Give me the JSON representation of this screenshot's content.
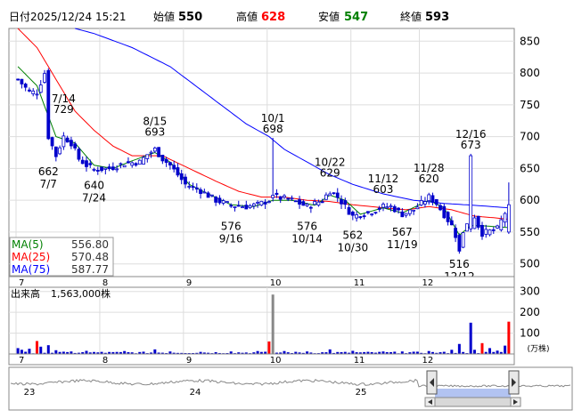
{
  "header": {
    "date_label": "日付",
    "date": "2025/12/24 15:21",
    "open_label": "始値",
    "open": "550",
    "high_label": "高値",
    "high": "628",
    "low_label": "安値",
    "low": "547",
    "close_label": "終値",
    "close": "593"
  },
  "colors": {
    "high": "#ff0000",
    "low": "#008000",
    "up": "#ffffff",
    "down": "#0000cc",
    "ma5": "#008000",
    "ma25": "#ff0000",
    "ma75": "#0000ff",
    "volume": "#0000cc",
    "volume_up": "#ff0000",
    "volume_spike": "#888888"
  },
  "legend": [
    {
      "label": "MA(5)",
      "value": "556.80",
      "color": "#008000"
    },
    {
      "label": "MA(25)",
      "value": "570.48",
      "color": "#ff0000"
    },
    {
      "label": "MA(75)",
      "value": "587.77",
      "color": "#0000ff"
    }
  ],
  "volume_label": "出来高",
  "volume_value": "1,563,000株",
  "volume_unit": "(万株)",
  "navigator_labels": [
    "23",
    "24",
    "25"
  ],
  "chart_data": [
    {
      "type": "candlestick",
      "ylim": [
        480,
        870
      ],
      "y_ticks": [
        500,
        550,
        600,
        650,
        700,
        750,
        800,
        850
      ],
      "month_labels": [
        "7",
        "8",
        "9",
        "10",
        "11",
        "12"
      ],
      "month_positions": [
        0,
        22,
        44,
        66,
        88,
        106
      ],
      "n": 130,
      "annotations": [
        {
          "date": "7/14",
          "value": "729",
          "i": 12,
          "kind": "high"
        },
        {
          "date": "7/7",
          "value": "662",
          "i": 8,
          "kind": "low"
        },
        {
          "date": "7/24",
          "value": "640",
          "i": 20,
          "kind": "low"
        },
        {
          "date": "8/15",
          "value": "693",
          "i": 36,
          "kind": "high"
        },
        {
          "date": "9/16",
          "value": "576",
          "i": 56,
          "kind": "low"
        },
        {
          "date": "10/1",
          "value": "698",
          "i": 67,
          "kind": "high"
        },
        {
          "date": "10/14",
          "value": "576",
          "i": 76,
          "kind": "low"
        },
        {
          "date": "10/22",
          "value": "629",
          "i": 82,
          "kind": "high"
        },
        {
          "date": "10/30",
          "value": "562",
          "i": 88,
          "kind": "low"
        },
        {
          "date": "11/12",
          "value": "603",
          "i": 96,
          "kind": "high"
        },
        {
          "date": "11/19",
          "value": "567",
          "i": 101,
          "kind": "low"
        },
        {
          "date": "11/28",
          "value": "620",
          "i": 108,
          "kind": "high"
        },
        {
          "date": "12/16",
          "value": "673",
          "i": 119,
          "kind": "high"
        },
        {
          "date": "12/12",
          "value": "516",
          "i": 116,
          "kind": "low"
        }
      ],
      "close_anchors": [
        [
          0,
          790
        ],
        [
          3,
          770
        ],
        [
          5,
          770
        ],
        [
          7,
          800
        ],
        [
          8,
          700
        ],
        [
          10,
          670
        ],
        [
          12,
          700
        ],
        [
          14,
          690
        ],
        [
          16,
          665
        ],
        [
          18,
          655
        ],
        [
          20,
          648
        ],
        [
          24,
          650
        ],
        [
          28,
          658
        ],
        [
          32,
          660
        ],
        [
          34,
          672
        ],
        [
          36,
          680
        ],
        [
          38,
          665
        ],
        [
          40,
          655
        ],
        [
          44,
          625
        ],
        [
          48,
          615
        ],
        [
          52,
          600
        ],
        [
          56,
          592
        ],
        [
          60,
          590
        ],
        [
          63,
          593
        ],
        [
          66,
          600
        ],
        [
          67,
          610
        ],
        [
          68,
          605
        ],
        [
          72,
          600
        ],
        [
          76,
          590
        ],
        [
          80,
          600
        ],
        [
          82,
          615
        ],
        [
          84,
          605
        ],
        [
          88,
          575
        ],
        [
          92,
          580
        ],
        [
          96,
          590
        ],
        [
          98,
          590
        ],
        [
          101,
          578
        ],
        [
          104,
          585
        ],
        [
          108,
          605
        ],
        [
          110,
          595
        ],
        [
          114,
          560
        ],
        [
          116,
          530
        ],
        [
          118,
          565
        ],
        [
          119,
          555
        ],
        [
          120,
          575
        ],
        [
          121,
          560
        ],
        [
          122,
          548
        ],
        [
          126,
          555
        ],
        [
          129,
          593
        ]
      ],
      "ma5_anchors": [
        [
          0,
          810
        ],
        [
          5,
          780
        ],
        [
          10,
          700
        ],
        [
          15,
          690
        ],
        [
          20,
          655
        ],
        [
          25,
          650
        ],
        [
          30,
          662
        ],
        [
          36,
          675
        ],
        [
          40,
          660
        ],
        [
          45,
          625
        ],
        [
          50,
          610
        ],
        [
          56,
          593
        ],
        [
          62,
          590
        ],
        [
          67,
          600
        ],
        [
          72,
          600
        ],
        [
          78,
          592
        ],
        [
          82,
          608
        ],
        [
          86,
          600
        ],
        [
          90,
          578
        ],
        [
          96,
          588
        ],
        [
          101,
          580
        ],
        [
          108,
          600
        ],
        [
          112,
          588
        ],
        [
          116,
          545
        ],
        [
          119,
          560
        ],
        [
          122,
          560
        ],
        [
          129,
          557
        ]
      ],
      "ma25_anchors": [
        [
          0,
          870
        ],
        [
          5,
          840
        ],
        [
          10,
          790
        ],
        [
          15,
          740
        ],
        [
          20,
          710
        ],
        [
          25,
          685
        ],
        [
          30,
          670
        ],
        [
          38,
          670
        ],
        [
          45,
          650
        ],
        [
          52,
          630
        ],
        [
          58,
          614
        ],
        [
          64,
          605
        ],
        [
          70,
          605
        ],
        [
          76,
          600
        ],
        [
          82,
          598
        ],
        [
          88,
          593
        ],
        [
          96,
          588
        ],
        [
          102,
          585
        ],
        [
          108,
          590
        ],
        [
          114,
          585
        ],
        [
          120,
          575
        ],
        [
          126,
          572
        ],
        [
          129,
          570
        ]
      ],
      "ma75_anchors": [
        [
          15,
          870
        ],
        [
          20,
          862
        ],
        [
          30,
          840
        ],
        [
          40,
          810
        ],
        [
          50,
          765
        ],
        [
          60,
          720
        ],
        [
          66,
          700
        ],
        [
          70,
          680
        ],
        [
          76,
          660
        ],
        [
          82,
          640
        ],
        [
          88,
          625
        ],
        [
          96,
          610
        ],
        [
          104,
          600
        ],
        [
          112,
          595
        ],
        [
          120,
          592
        ],
        [
          129,
          588
        ]
      ],
      "special_candles": [
        {
          "i": 67,
          "open": 604,
          "close": 608,
          "high": 698,
          "low": 598
        },
        {
          "i": 119,
          "open": 555,
          "close": 670,
          "high": 673,
          "low": 550
        },
        {
          "i": 116,
          "open": 545,
          "close": 520,
          "high": 548,
          "low": 516
        },
        {
          "i": 129,
          "open": 550,
          "close": 593,
          "high": 628,
          "low": 547
        }
      ]
    },
    {
      "type": "bar",
      "ylim": [
        0,
        320
      ],
      "y_ticks": [
        100,
        200,
        300
      ],
      "month_labels": [
        "7",
        "8",
        "9",
        "10",
        "11",
        "12"
      ],
      "values_sparse": [
        [
          0,
          28
        ],
        [
          1,
          20
        ],
        [
          3,
          25
        ],
        [
          5,
          62
        ],
        [
          6,
          35
        ],
        [
          8,
          42
        ],
        [
          10,
          18
        ],
        [
          14,
          12
        ],
        [
          18,
          15
        ],
        [
          22,
          10
        ],
        [
          28,
          14
        ],
        [
          36,
          22
        ],
        [
          40,
          12
        ],
        [
          48,
          10
        ],
        [
          56,
          12
        ],
        [
          63,
          14
        ],
        [
          66,
          60
        ],
        [
          67,
          285
        ],
        [
          70,
          14
        ],
        [
          76,
          12
        ],
        [
          82,
          22
        ],
        [
          88,
          15
        ],
        [
          96,
          12
        ],
        [
          101,
          12
        ],
        [
          108,
          14
        ],
        [
          114,
          20
        ],
        [
          116,
          48
        ],
        [
          119,
          150
        ],
        [
          120,
          20
        ],
        [
          122,
          52
        ],
        [
          124,
          28
        ],
        [
          126,
          16
        ],
        [
          128,
          40
        ],
        [
          129,
          155
        ]
      ]
    }
  ]
}
